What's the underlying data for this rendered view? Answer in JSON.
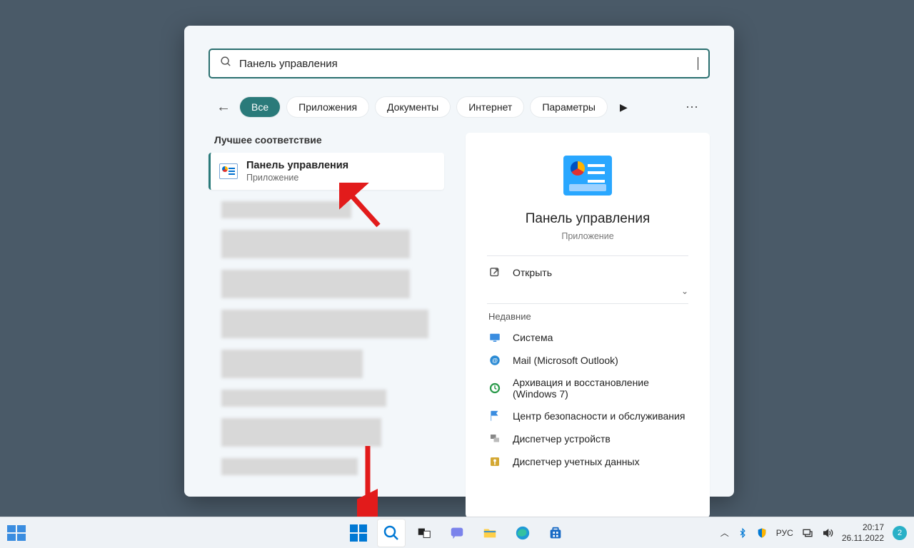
{
  "search": {
    "query": "Панель управления",
    "placeholder": ""
  },
  "filters": {
    "back": "←",
    "items": [
      "Все",
      "Приложения",
      "Документы",
      "Интернет",
      "Параметры"
    ],
    "active_index": 0,
    "more": "▶",
    "ellipsis": "⋯"
  },
  "best_match": {
    "section_title": "Лучшее соответствие",
    "title": "Панель управления",
    "subtitle": "Приложение"
  },
  "detail": {
    "title": "Панель управления",
    "subtitle": "Приложение",
    "actions": {
      "open": "Открыть"
    },
    "recent_title": "Недавние",
    "recent": [
      "Система",
      "Mail (Microsoft Outlook)",
      "Архивация и восстановление (Windows 7)",
      "Центр безопасности и обслуживания",
      "Диспетчер устройств",
      "Диспетчер учетных данных"
    ]
  },
  "taskbar": {
    "lang": "РУС",
    "time": "20:17",
    "date": "26.11.2022",
    "notif_count": "2"
  }
}
